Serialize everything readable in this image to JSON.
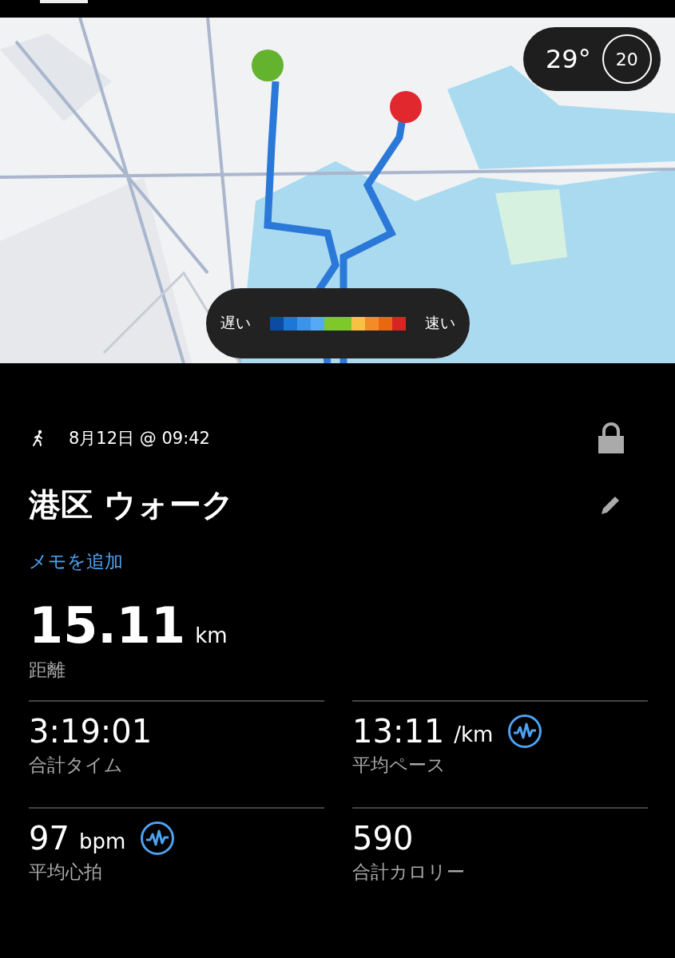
{
  "map": {
    "weather": {
      "temperature": "29°",
      "index": "20"
    },
    "legend": {
      "slow_label": "遅い",
      "fast_label": "速い",
      "segments": [
        {
          "color": "#0b4ba3"
        },
        {
          "color": "#1b78d6"
        },
        {
          "color": "#3a93ea"
        },
        {
          "color": "#56a9f6"
        },
        {
          "color": "#7ec82a"
        },
        {
          "color": "#7ec82a"
        },
        {
          "color": "#f7c244"
        },
        {
          "color": "#f58b27"
        },
        {
          "color": "#e8670f"
        },
        {
          "color": "#d92424"
        }
      ]
    }
  },
  "activity": {
    "date": "8月12日 @ 09:42",
    "locked": true,
    "title": "港区 ウォーク",
    "note_link": "メモを追加"
  },
  "distance": {
    "value": "15.11",
    "unit": "km",
    "label": "距離"
  },
  "stats": [
    {
      "value": "3:19:01",
      "label": "合計タイム",
      "chart_icon": false
    },
    {
      "value": "13:11",
      "unit": "/km",
      "label": "平均ペース",
      "chart_icon": true
    },
    {
      "value": "97",
      "unit": "bpm",
      "label": "平均心拍",
      "chart_icon": true
    },
    {
      "value": "590",
      "label": "合計カロリー",
      "chart_icon": false
    }
  ]
}
